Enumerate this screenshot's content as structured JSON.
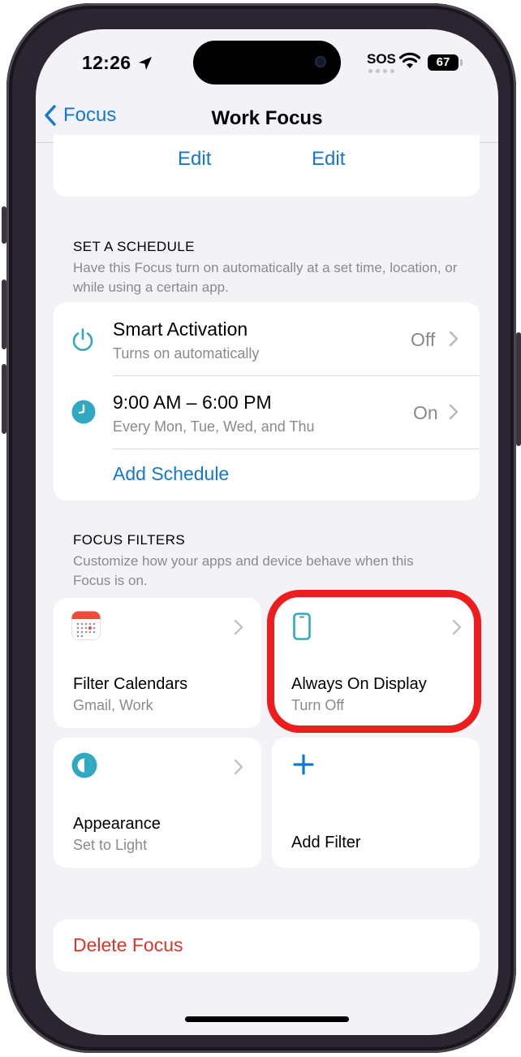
{
  "status_bar": {
    "time": "12:26",
    "sos": "SOS",
    "battery": "67"
  },
  "nav": {
    "back_label": "Focus",
    "title": "Work Focus"
  },
  "top_card": {
    "left_edit": "Edit",
    "right_edit": "Edit"
  },
  "schedule": {
    "heading": "SET A SCHEDULE",
    "description": "Have this Focus turn on automatically at a set time, location, or while using a certain app.",
    "rows": [
      {
        "title": "Smart Activation",
        "subtitle": "Turns on automatically",
        "value": "Off",
        "icon": "power-icon"
      },
      {
        "title": "9:00 AM – 6:00 PM",
        "subtitle": "Every Mon, Tue, Wed, and Thu",
        "value": "On",
        "icon": "clock-icon"
      }
    ],
    "add_label": "Add Schedule"
  },
  "filters": {
    "heading": "FOCUS FILTERS",
    "description": "Customize how your apps and device behave when this Focus is on.",
    "tiles": [
      {
        "title": "Filter Calendars",
        "subtitle": "Gmail, Work",
        "icon": "calendar-icon"
      },
      {
        "title": "Always On Display",
        "subtitle": "Turn Off",
        "icon": "phone-icon"
      },
      {
        "title": "Appearance",
        "subtitle": "Set to Light",
        "icon": "appearance-icon"
      },
      {
        "title": "Add Filter",
        "icon": "plus-icon"
      }
    ]
  },
  "delete_label": "Delete Focus",
  "colors": {
    "accent": "#1477d4",
    "destructive": "#e0342a",
    "highlight": "#ee1c1c",
    "teal": "#31a8c2"
  }
}
